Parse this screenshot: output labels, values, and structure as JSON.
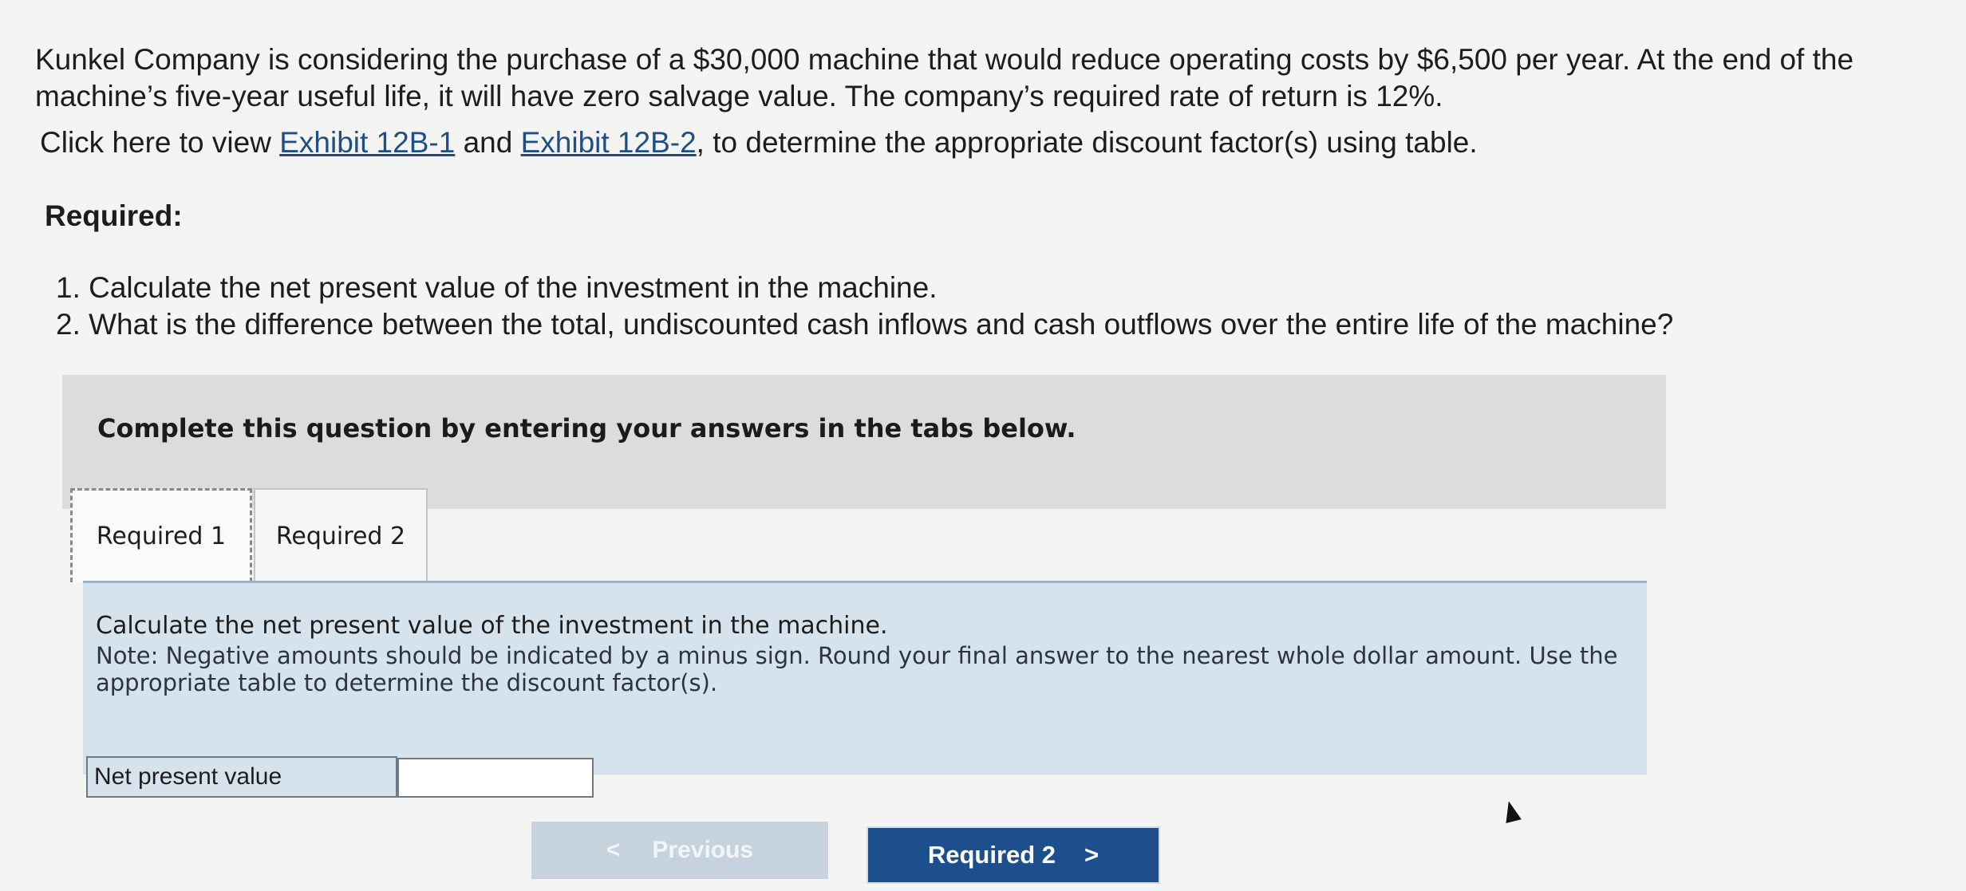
{
  "problem": {
    "text": "Kunkel Company is considering the purchase of a $30,000 machine that would reduce operating costs by $6,500 per year. At the end of the machine’s five-year useful life, it will have zero salvage value. The company’s required rate of return is 12%.",
    "click_prefix": "Click here to view ",
    "link1": "Exhibit 12B-1",
    "and": " and ",
    "link2": "Exhibit 12B-2",
    "click_suffix": ", to determine the appropriate discount factor(s) using table."
  },
  "required": {
    "heading": "Required:",
    "items": [
      "1. Calculate the net present value of the investment in the machine.",
      "2. What is the difference between the total, undiscounted cash inflows and cash outflows over the entire life of the machine?"
    ]
  },
  "panel": {
    "instruction": "Complete this question by entering your answers in the tabs below."
  },
  "tabs": [
    {
      "label": "Required 1"
    },
    {
      "label": "Required 2"
    }
  ],
  "content": {
    "main": "Calculate the net present value of the investment in the machine.",
    "note": "Note: Negative amounts should be indicated by a minus sign. Round your final answer to the nearest whole dollar amount. Use the appropriate table to determine the discount factor(s)."
  },
  "field": {
    "label": "Net present value",
    "value": ""
  },
  "nav": {
    "prev_label": "Previous",
    "prev_icon": "<",
    "next_label": "Required 2",
    "next_icon": ">"
  }
}
